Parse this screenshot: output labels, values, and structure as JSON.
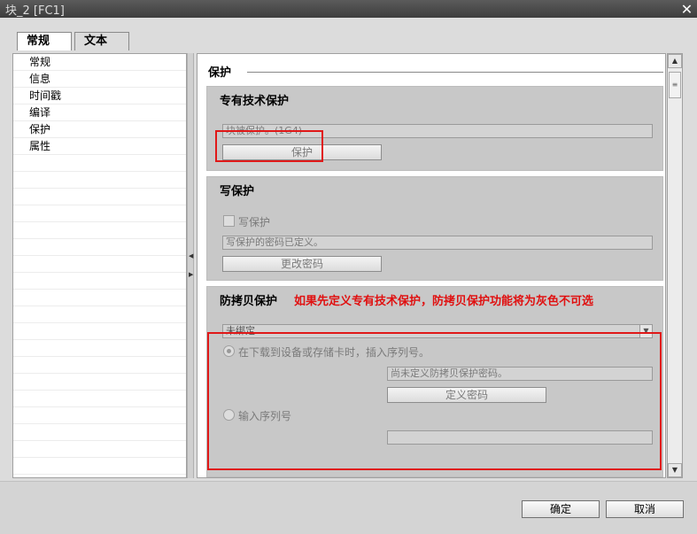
{
  "window": {
    "title": "块_2 [FC1]",
    "close_icon": "close-icon"
  },
  "tabs": [
    {
      "label": "常规",
      "active": true
    },
    {
      "label": "文本",
      "active": false
    }
  ],
  "nav": {
    "items": [
      "常规",
      "信息",
      "时间戳",
      "编译",
      "保护",
      "属性"
    ],
    "selected": "保护"
  },
  "content": {
    "section_title": "保护",
    "know_how": {
      "title": "专有技术保护",
      "field_value": "块被保护。(1G4)",
      "button_label": "保护"
    },
    "write_protect": {
      "title": "写保护",
      "checkbox_label": "写保护",
      "field_value": "写保护的密码已定义。",
      "button_label": "更改密码"
    },
    "copy_protect": {
      "title": "防拷贝保护",
      "annotation": "如果先定义专有技术保护，防拷贝保护功能将为灰色不可选",
      "dropdown_value": "未绑定",
      "radio1_label": "在下载到设备或存储卡时，插入序列号。",
      "password_field": "尚未定义防拷贝保护密码。",
      "define_password_button": "定义密码",
      "radio2_label": "输入序列号",
      "serial_field": ""
    }
  },
  "footer": {
    "ok_label": "确定",
    "cancel_label": "取消"
  },
  "colors": {
    "annotation_red": "#e01010",
    "disabled_text": "#7a7a7a",
    "group_bg": "#c8c8c8"
  }
}
